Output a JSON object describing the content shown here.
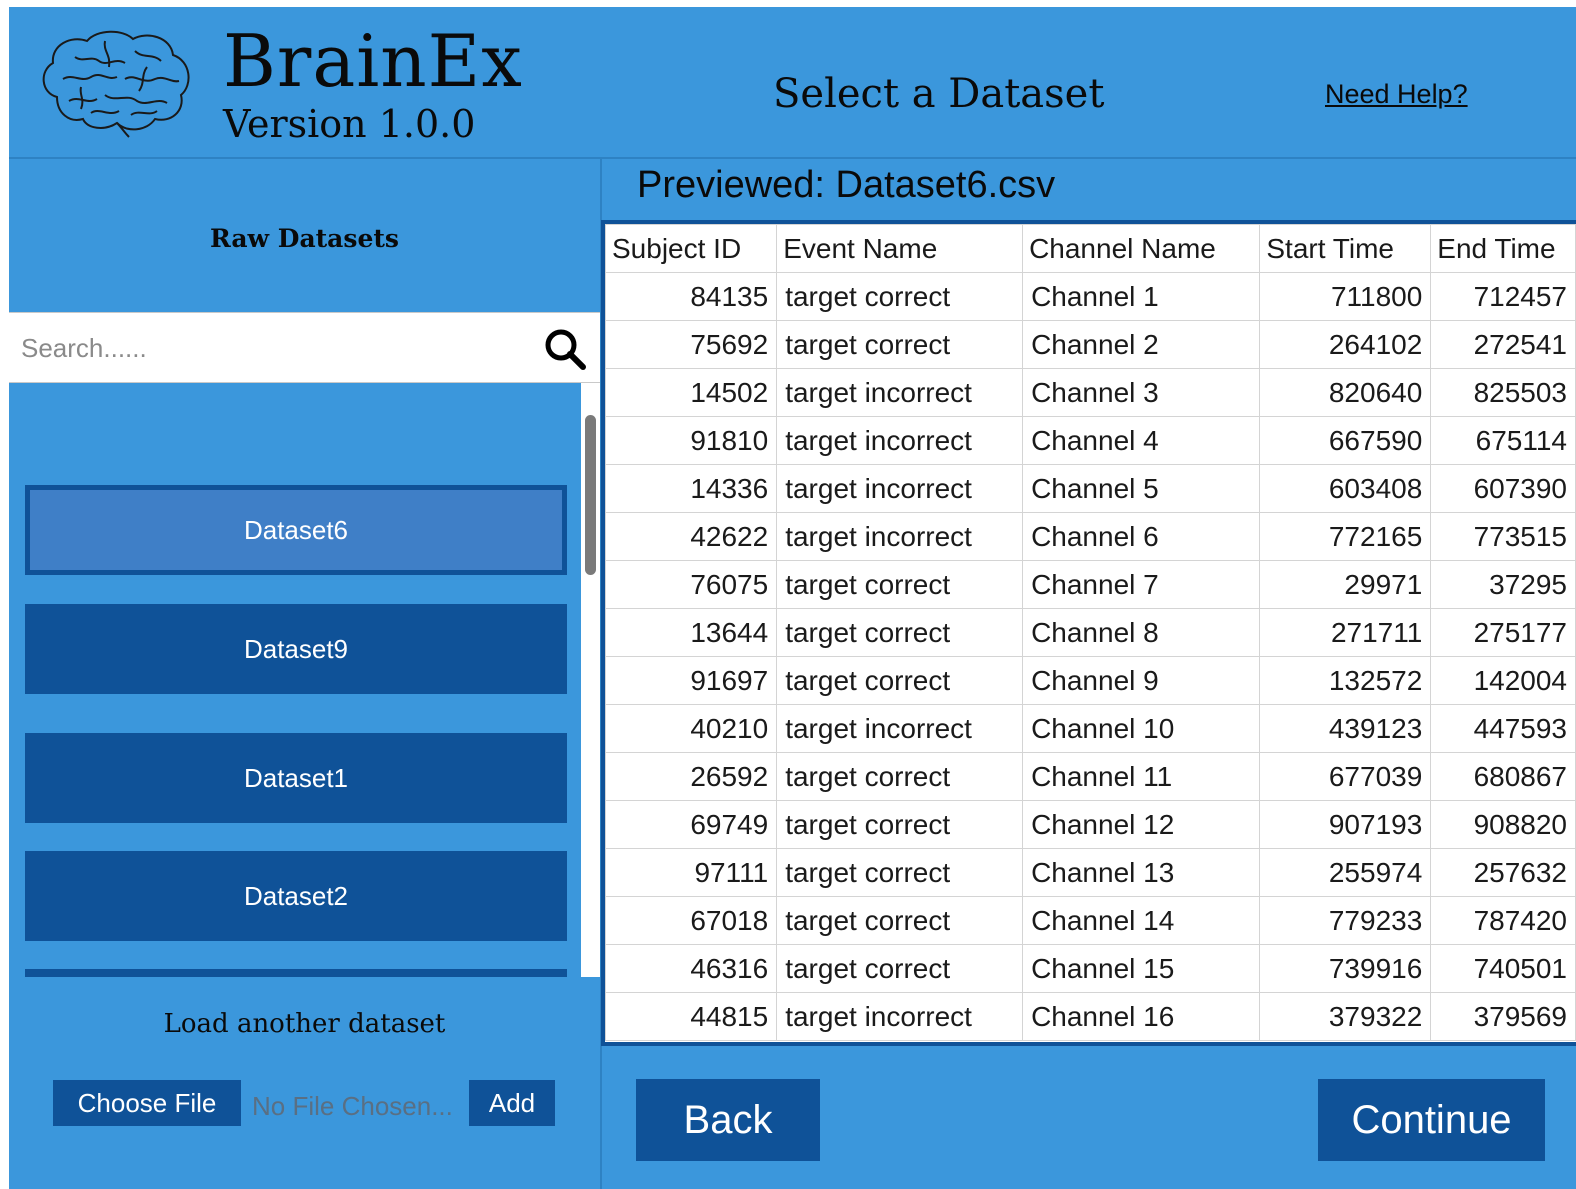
{
  "header": {
    "app_name": "BrainEx",
    "version": "Version 1.0.0",
    "page_title": "Select a Dataset",
    "help_link": "Need Help?"
  },
  "sidebar": {
    "title": "Raw Datasets",
    "search_placeholder": "Search......",
    "datasets": [
      {
        "label": "Dataset6",
        "selected": true
      },
      {
        "label": "Dataset9",
        "selected": false
      },
      {
        "label": "Dataset1",
        "selected": false
      },
      {
        "label": "Dataset2",
        "selected": false
      },
      {
        "label": "",
        "selected": false
      }
    ],
    "load": {
      "title": "Load another dataset",
      "choose_label": "Choose File",
      "no_file_text": "No File Chosen...",
      "add_label": "Add"
    }
  },
  "preview": {
    "title": "Previewed: Dataset6.csv",
    "columns": [
      "Subject ID",
      "Event Name",
      "Channel Name",
      "Start Time",
      "End Time"
    ],
    "rows": [
      [
        "84135",
        "target correct",
        "Channel 1",
        "711800",
        "712457"
      ],
      [
        "75692",
        "target correct",
        "Channel 2",
        "264102",
        "272541"
      ],
      [
        "14502",
        "target incorrect",
        "Channel 3",
        "820640",
        "825503"
      ],
      [
        "91810",
        "target incorrect",
        "Channel 4",
        "667590",
        "675114"
      ],
      [
        "14336",
        "target incorrect",
        "Channel 5",
        "603408",
        "607390"
      ],
      [
        "42622",
        "target incorrect",
        "Channel 6",
        "772165",
        "773515"
      ],
      [
        "76075",
        "target correct",
        "Channel 7",
        "29971",
        "37295"
      ],
      [
        "13644",
        "target correct",
        "Channel 8",
        "271711",
        "275177"
      ],
      [
        "91697",
        "target correct",
        "Channel 9",
        "132572",
        "142004"
      ],
      [
        "40210",
        "target incorrect",
        "Channel 10",
        "439123",
        "447593"
      ],
      [
        "26592",
        "target correct",
        "Channel 11",
        "677039",
        "680867"
      ],
      [
        "69749",
        "target correct",
        "Channel 12",
        "907193",
        "908820"
      ],
      [
        "97111",
        "target correct",
        "Channel 13",
        "255974",
        "257632"
      ],
      [
        "67018",
        "target correct",
        "Channel 14",
        "779233",
        "787420"
      ],
      [
        "46316",
        "target correct",
        "Channel 15",
        "739916",
        "740501"
      ],
      [
        "44815",
        "target incorrect",
        "Channel 16",
        "379322",
        "379569"
      ]
    ]
  },
  "footer": {
    "back_label": "Back",
    "continue_label": "Continue"
  },
  "colors": {
    "background": "#3b97dc",
    "button": "#0f5298",
    "selected_button": "#3f7fc7"
  },
  "icons": {
    "logo": "brain-logo",
    "search": "search-icon"
  }
}
